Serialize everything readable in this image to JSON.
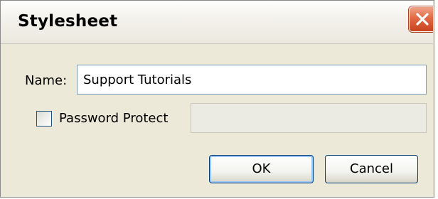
{
  "dialog": {
    "title": "Stylesheet"
  },
  "name": {
    "label": "Name:",
    "value": "Support Tutorials"
  },
  "password": {
    "checkbox_label": "Password Protect",
    "checked": false,
    "value": ""
  },
  "buttons": {
    "ok_label": "OK",
    "cancel_label": "Cancel"
  },
  "icons": {
    "close": "close-icon"
  },
  "colors": {
    "close_button": "#e16a44",
    "dialog_background": "#ece9d8",
    "default_button_focus": "#9cc6f6"
  }
}
